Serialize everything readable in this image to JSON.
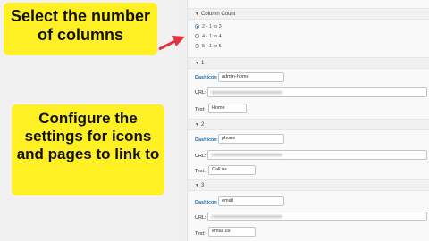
{
  "annotations": {
    "top_callout": "Select the number of columns",
    "bottom_callout": "Configure the settings for icons and pages to link to"
  },
  "column_count": {
    "heading": "Column Count",
    "options": [
      {
        "label": "2 - 1 to 3",
        "selected": true
      },
      {
        "label": "4 - 1 to 4",
        "selected": false
      },
      {
        "label": "5 - 1 to 5",
        "selected": false
      }
    ]
  },
  "items": [
    {
      "heading": "1",
      "dashicon_label": "Dashicon",
      "dashicon_value": "admin-home",
      "url_label": "URL:",
      "text_label": "Text:",
      "text_value": "Home"
    },
    {
      "heading": "2",
      "dashicon_label": "Dashicon",
      "dashicon_value": "phone",
      "url_label": "URL:",
      "text_label": "Text:",
      "text_value": "Call us"
    },
    {
      "heading": "3",
      "dashicon_label": "Dashicon",
      "dashicon_value": "email",
      "url_label": "URL:",
      "text_label": "Text:",
      "text_value": "email us"
    }
  ],
  "colors": {
    "callout": "#fff024",
    "arrow": "#e0343c",
    "link_blue": "#2271b1"
  },
  "icons": {
    "caret": "caret-down-icon",
    "arrow": "pointer-arrow"
  }
}
